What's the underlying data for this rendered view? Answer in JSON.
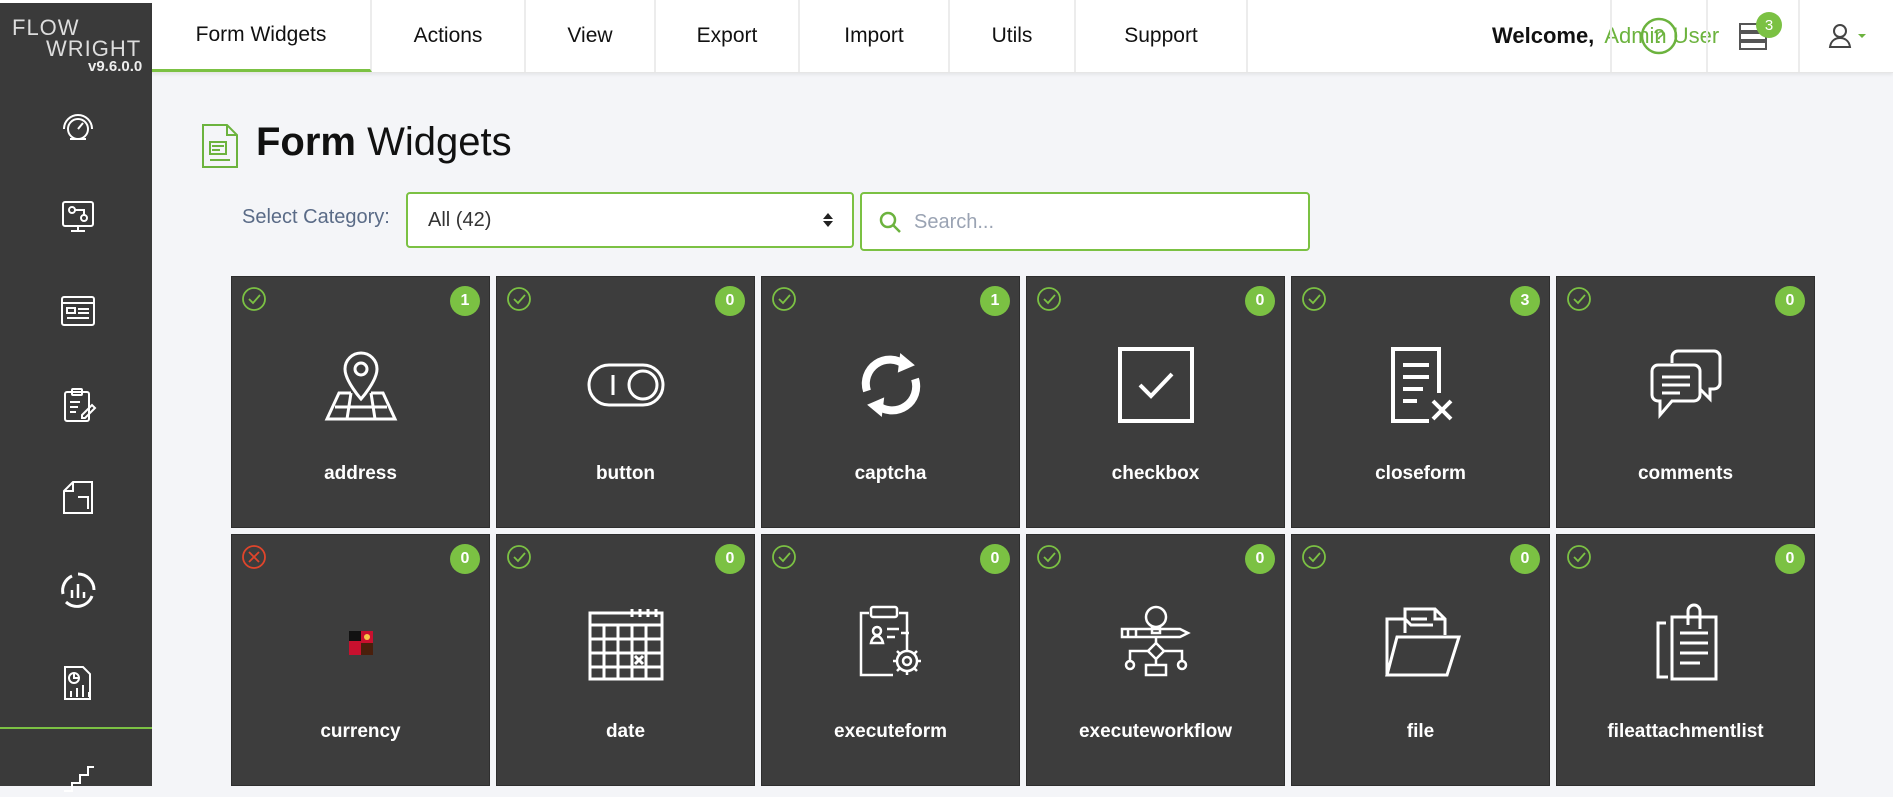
{
  "app": {
    "logo_line1": "FLOW",
    "logo_line2": "WRIGHT",
    "version": "v9.6.0.0"
  },
  "nav": {
    "tabs": [
      {
        "label": "Form Widgets"
      },
      {
        "label": "Actions"
      },
      {
        "label": "View"
      },
      {
        "label": "Export"
      },
      {
        "label": "Import"
      },
      {
        "label": "Utils"
      },
      {
        "label": "Support"
      }
    ],
    "active_tab": "Form Widgets",
    "welcome": "Welcome,",
    "user": "Admin User",
    "help_icon": "question-circle-icon",
    "notifications_icon": "server-stack-icon",
    "notifications_count": "3",
    "user_menu_icon": "user-icon"
  },
  "sidebar": {
    "items": [
      {
        "icon": "dashboard-gauge-icon"
      },
      {
        "icon": "workflow-design-icon"
      },
      {
        "icon": "form-list-icon"
      },
      {
        "icon": "clipboard-edit-icon"
      },
      {
        "icon": "document-icon"
      },
      {
        "icon": "analytics-icon"
      },
      {
        "icon": "report-chart-icon"
      },
      {
        "icon": "stairs-icon"
      }
    ]
  },
  "page": {
    "title_bold": "Form",
    "title_rest": "Widgets",
    "category_label": "Select Category:",
    "category_value": "All (42)",
    "search_placeholder": "Search..."
  },
  "widgets": [
    {
      "name": "address",
      "count": "1",
      "status": "ok",
      "icon": "map-pin-icon"
    },
    {
      "name": "button",
      "count": "0",
      "status": "ok",
      "icon": "toggle-button-icon"
    },
    {
      "name": "captcha",
      "count": "1",
      "status": "ok",
      "icon": "refresh-icon"
    },
    {
      "name": "checkbox",
      "count": "0",
      "status": "ok",
      "icon": "checkbox-icon"
    },
    {
      "name": "closeform",
      "count": "3",
      "status": "ok",
      "icon": "close-document-icon"
    },
    {
      "name": "comments",
      "count": "0",
      "status": "ok",
      "icon": "comments-icon"
    },
    {
      "name": "currency",
      "count": "0",
      "status": "error",
      "icon": "broken-image-icon"
    },
    {
      "name": "date",
      "count": "0",
      "status": "ok",
      "icon": "calendar-icon"
    },
    {
      "name": "executeform",
      "count": "0",
      "status": "ok",
      "icon": "clipboard-gear-icon"
    },
    {
      "name": "executeworkflow",
      "count": "0",
      "status": "ok",
      "icon": "workflow-idea-icon"
    },
    {
      "name": "file",
      "count": "0",
      "status": "ok",
      "icon": "folder-icon"
    },
    {
      "name": "fileattachmentlist",
      "count": "0",
      "status": "ok",
      "icon": "attachment-list-icon"
    }
  ],
  "colors": {
    "accent": "#7bc143",
    "card": "#3d3d3d",
    "sidebar": "#3a3a3a",
    "error": "#e0452b"
  }
}
